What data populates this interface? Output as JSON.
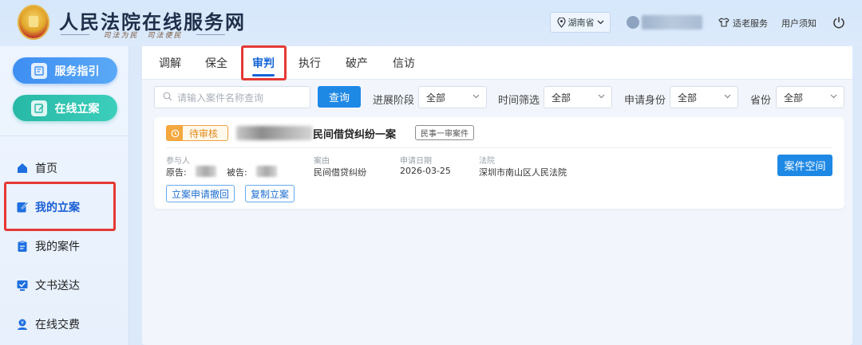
{
  "header": {
    "site_title": "人民法院在线服务网",
    "slogan": "司法为民　司法便民",
    "province": "湖南省",
    "elder_service": "适老服务",
    "user_notice": "用户须知"
  },
  "sidebar": {
    "guide_label": "服务指引",
    "file_label": "在线立案",
    "items": [
      {
        "label": "首页",
        "icon": "home-icon"
      },
      {
        "label": "我的立案",
        "icon": "edit-icon"
      },
      {
        "label": "我的案件",
        "icon": "clipboard-icon"
      },
      {
        "label": "文书送达",
        "icon": "inbox-icon"
      },
      {
        "label": "在线交费",
        "icon": "payment-icon"
      }
    ]
  },
  "tabs": [
    {
      "label": "调解"
    },
    {
      "label": "保全"
    },
    {
      "label": "审判"
    },
    {
      "label": "执行"
    },
    {
      "label": "破产"
    },
    {
      "label": "信访"
    }
  ],
  "filters": {
    "search_placeholder": "请输入案件名称查询",
    "query_label": "查询",
    "stage_label": "进展阶段",
    "stage_value": "全部",
    "time_label": "时间筛选",
    "time_value": "全部",
    "identity_label": "申请身份",
    "identity_value": "全部",
    "province_label": "省份",
    "province_value": "全部"
  },
  "case": {
    "status": "待审核",
    "title": "民间借贷纠纷一案",
    "type_tag": "民事一审案件",
    "participants_label": "参与人",
    "plaintiff_label": "原告:",
    "defendant_label": "被告:",
    "cause_label": "案由",
    "cause_value": "民间借贷纠纷",
    "date_label": "申请日期",
    "date_value": "2026-03-25",
    "court_label": "法院",
    "court_value": "深圳市南山区人民法院",
    "space_button": "案件空间",
    "withdraw_button": "立案申请撤回",
    "copy_button": "复制立案"
  },
  "colors": {
    "primary": "#1e88e5",
    "highlight": "#e53935",
    "status": "#f0a23b",
    "teal": "#27b8a6"
  }
}
